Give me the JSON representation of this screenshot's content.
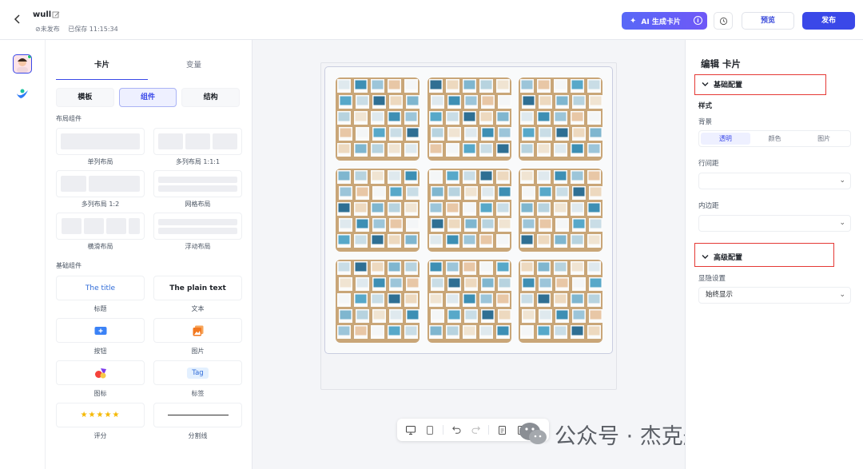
{
  "header": {
    "doc_title": "wull",
    "status_unpublished": "⊘未发布",
    "status_saved": "已保存 11:15:34",
    "ai_button_label": "AI 生成卡片",
    "preview_label": "预览",
    "publish_label": "发布"
  },
  "panel": {
    "tabs": [
      "卡片",
      "变量"
    ],
    "segments": [
      "模板",
      "组件",
      "结构"
    ],
    "layout_section": "布局组件",
    "layout_items": [
      "单列布局",
      "多列布局 1:1:1",
      "多列布局 1:2",
      "网格布局",
      "横滑布局",
      "浮动布局"
    ],
    "basic_section": "基础组件",
    "title_sample": "The title",
    "text_sample": "The plain text",
    "tag_sample": "Tag",
    "rating_stars": "★★★★★",
    "basic_items": [
      "标题",
      "文本",
      "按钮",
      "图片",
      "图标",
      "标签",
      "评分",
      "分割线"
    ]
  },
  "props": {
    "title": "编辑 卡片",
    "basic_group": "基础配置",
    "style_label": "样式",
    "background_label": "背景",
    "background_options": [
      "透明",
      "颜色",
      "图片"
    ],
    "line_spacing_label": "行间距",
    "padding_label": "内边距",
    "advanced_group": "高级配置",
    "visibility_label": "显隐设置",
    "visibility_value": "始终显示"
  },
  "watermark": {
    "text": "公众号 · 杰克船长的AIGC"
  },
  "colors": {
    "accent": "#3a48e8",
    "highlight_box": "#e53935"
  }
}
